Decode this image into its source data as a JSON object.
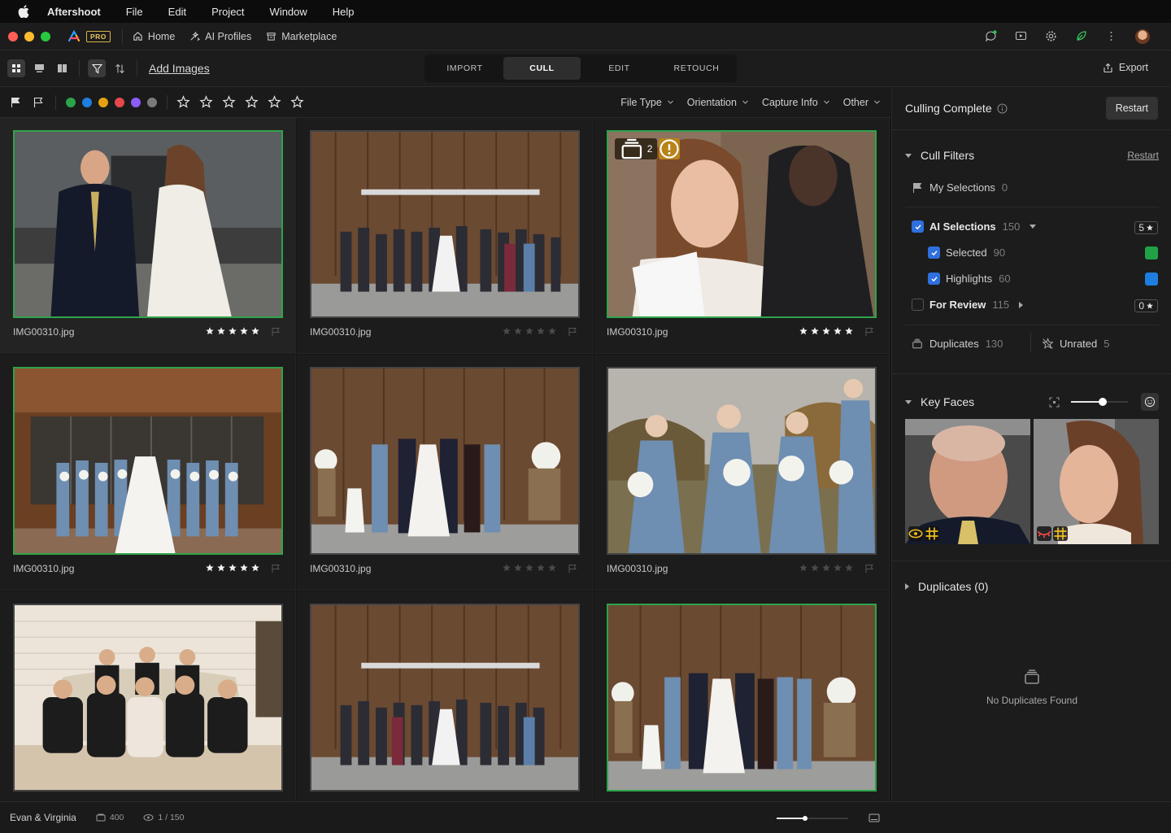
{
  "menubar": {
    "app_name": "Aftershoot",
    "menus": [
      "File",
      "Edit",
      "Project",
      "Window",
      "Help"
    ]
  },
  "titlebar": {
    "pro_badge": "PRO",
    "nav": [
      {
        "label": "Home",
        "icon": "home-icon"
      },
      {
        "label": "AI Profiles",
        "icon": "sparkle-icon"
      },
      {
        "label": "Marketplace",
        "icon": "store-icon"
      }
    ]
  },
  "toolbar": {
    "add_images": "Add Images",
    "tabs": [
      "IMPORT",
      "CULL",
      "EDIT",
      "RETOUCH"
    ],
    "active_tab": "CULL",
    "export": "Export"
  },
  "filters": {
    "color_labels": [
      "#2aa44a",
      "#1e7ee0",
      "#e5a012",
      "#e5484d",
      "#8b5cf6",
      "#7a7a7a"
    ],
    "dropdowns": [
      "File Type",
      "Orientation",
      "Capture Info",
      "Other"
    ]
  },
  "grid": {
    "images": [
      {
        "name": "IMG00310.jpg",
        "stars": 5,
        "selected": true,
        "frame": "green"
      },
      {
        "name": "IMG00310.jpg",
        "stars": 0,
        "selected": false,
        "frame": "gray"
      },
      {
        "name": "IMG00310.jpg",
        "stars": 5,
        "selected": false,
        "frame": "green",
        "stack_count": "2"
      },
      {
        "name": "IMG00310.jpg",
        "stars": 5,
        "selected": false,
        "frame": "green"
      },
      {
        "name": "IMG00310.jpg",
        "stars": 0,
        "selected": false,
        "frame": "gray"
      },
      {
        "name": "IMG00310.jpg",
        "stars": 0,
        "selected": false,
        "frame": "gray"
      },
      {
        "name": "",
        "stars": 0,
        "selected": false,
        "frame": "gray"
      },
      {
        "name": "",
        "stars": 0,
        "selected": false,
        "frame": "gray"
      },
      {
        "name": "",
        "stars": 0,
        "selected": false,
        "frame": "green"
      }
    ]
  },
  "panel": {
    "title": "Culling Complete",
    "restart_button": "Restart",
    "cull_filters": {
      "title": "Cull Filters",
      "restart_link": "Restart",
      "my_selections": {
        "label": "My Selections",
        "count": "0"
      },
      "ai_selections": {
        "label": "AI Selections",
        "count": "150",
        "pill": "5"
      },
      "selected": {
        "label": "Selected",
        "count": "90",
        "color": "#22a046"
      },
      "highlights": {
        "label": "Highlights",
        "count": "60",
        "color": "#1e7ee0"
      },
      "for_review": {
        "label": "For Review",
        "count": "115",
        "pill": "0"
      },
      "duplicates": {
        "label": "Duplicates",
        "count": "130"
      },
      "unrated": {
        "label": "Unrated",
        "count": "5"
      }
    },
    "key_faces": {
      "title": "Key Faces",
      "size_level": 0.55
    },
    "duplicates_section": {
      "title": "Duplicates (0)",
      "empty_text": "No Duplicates Found"
    }
  },
  "statusbar": {
    "project": "Evan & Virginia",
    "image_count": "400",
    "viewing": "1 / 150",
    "zoom_level": 0.4
  }
}
